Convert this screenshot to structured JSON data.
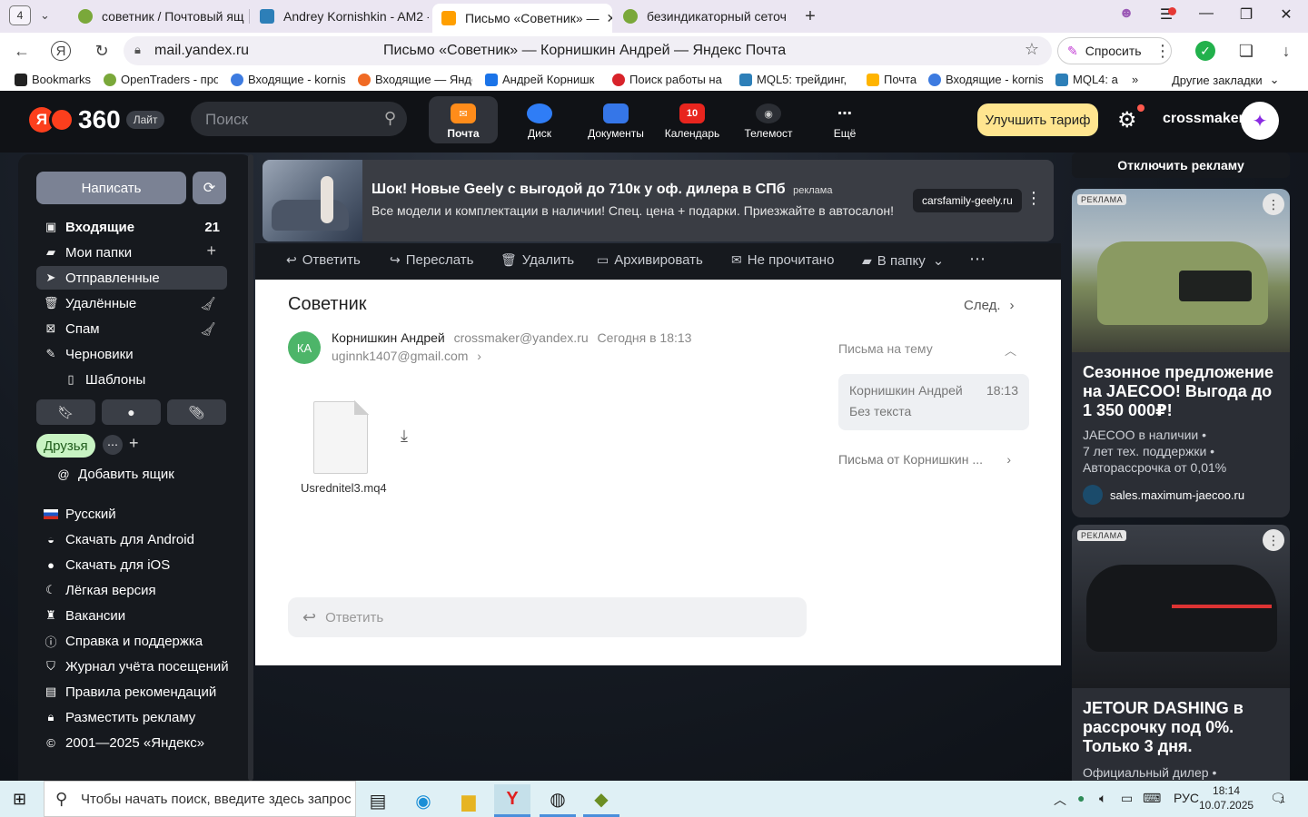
{
  "browser": {
    "tab_count": "4",
    "tabs": [
      {
        "label": "советник / Почтовый ящ",
        "icon": "opentraders-icon"
      },
      {
        "label": "Andrey Kornishkin - AM2 -",
        "icon": "mql5-icon"
      },
      {
        "label": "Письмо «Советник» —",
        "icon": "yandex-mail-icon",
        "active": true
      },
      {
        "label": "безиндикаторный сеточ",
        "icon": "opentraders-icon"
      }
    ],
    "url": "mail.yandex.ru",
    "page_title": "Письмо «Советник» — Корнишкин Андрей — Яндекс Почта",
    "ask_label": "Спросить",
    "bookmarks": [
      {
        "label": "Bookmarks",
        "color": "#222222"
      },
      {
        "label": "OpenTraders - про",
        "color": "#7aa83a"
      },
      {
        "label": "Входящие - kornis",
        "color": "#3d7be0"
      },
      {
        "label": "Входящие — Янде",
        "color": "#f06a24"
      },
      {
        "label": "Андрей Корнишк",
        "color": "#1a73e8"
      },
      {
        "label": "Поиск работы на",
        "color": "#d8232a"
      },
      {
        "label": "MQL5: трейдинг,",
        "color": "#2d7fb8"
      },
      {
        "label": "Почта",
        "color": "#ffb400"
      },
      {
        "label": "Входящие - kornis",
        "color": "#3d7be0"
      },
      {
        "label": "MQL4: а",
        "color": "#2d7fb8"
      }
    ],
    "bookmarks_more": "»",
    "other_bookmarks": "Другие закладки"
  },
  "header": {
    "logo_text": "360",
    "logo_letter": "Я",
    "lite_badge": "Лайт",
    "search_placeholder": "Поиск",
    "services": [
      {
        "label": "Почта",
        "icon": "mail-icon",
        "active": true
      },
      {
        "label": "Диск",
        "icon": "disk-icon"
      },
      {
        "label": "Документы",
        "icon": "documents-icon"
      },
      {
        "label": "Календарь",
        "icon": "calendar-icon",
        "badge": "10"
      },
      {
        "label": "Телемост",
        "icon": "telemost-icon"
      },
      {
        "label": "Ещё",
        "icon": "more-icon"
      }
    ],
    "upgrade_label": "Улучшить тариф",
    "username": "crossmaker"
  },
  "sidebar": {
    "compose_label": "Написать",
    "folders": [
      {
        "label": "Входящие",
        "count": "21",
        "icon": "inbox-icon",
        "bold": true
      },
      {
        "label": "Мои папки",
        "action": "+",
        "icon": "folder-icon"
      },
      {
        "label": "Отправленные",
        "icon": "sent-icon",
        "selected": true
      },
      {
        "label": "Удалённые",
        "action": "clean",
        "icon": "trash-icon"
      },
      {
        "label": "Спам",
        "action": "clean",
        "icon": "spam-icon"
      },
      {
        "label": "Черновики",
        "icon": "drafts-icon"
      },
      {
        "label": "Шаблоны",
        "icon": "template-icon",
        "indent": true
      }
    ],
    "label_chip": "Друзья",
    "add_mailbox": "Добавить ящик",
    "links": [
      {
        "label": "Русский",
        "icon": "russia-flag-icon"
      },
      {
        "label": "Скачать для Android",
        "icon": "android-icon"
      },
      {
        "label": "Скачать для iOS",
        "icon": "apple-icon"
      },
      {
        "label": "Лёгкая версия",
        "icon": "moon-icon"
      },
      {
        "label": "Вакансии",
        "icon": "vacancy-icon"
      },
      {
        "label": "Справка и поддержка",
        "icon": "info-icon"
      },
      {
        "label": "Журнал учёта посещений",
        "icon": "shield-icon"
      },
      {
        "label": "Правила рекомендаций",
        "icon": "rules-icon"
      },
      {
        "label": "Разместить рекламу",
        "icon": "lock-icon"
      },
      {
        "label": "2001—2025 «Яндекс»",
        "icon": "copyright-icon"
      }
    ]
  },
  "top_ad": {
    "title": "Шок! Новые Geely с выгодой до 710к у оф. дилера в СПб",
    "ad_label": "реклама",
    "text": "Все модели и комплектации в наличии! Спец. цена + подарки. Приезжайте в автосалон!",
    "domain": "carsfamily-geely.ru"
  },
  "toolbar": {
    "reply": "Ответить",
    "forward": "Переслать",
    "delete": "Удалить",
    "archive": "Архивировать",
    "unread": "Не прочитано",
    "to_folder": "В папку",
    "more": "⋯"
  },
  "letter": {
    "subject": "Советник",
    "next": "След.",
    "avatar_initials": "КА",
    "sender_name": "Корнишкин Андрей",
    "sender_email": "crossmaker@yandex.ru",
    "date": "Сегодня в 18:13",
    "recipient": "uginnk1407@gmail.com",
    "attachment_name": "Usrednitel3.mq4",
    "reply_placeholder": "Ответить"
  },
  "thread": {
    "title": "Письма на тему",
    "item_sender": "Корнишкин Андрей",
    "item_time": "18:13",
    "item_body": "Без текста",
    "from_sender": "Письма от Корнишкин ..."
  },
  "right_ads": {
    "disable_label": "Отключить рекламу",
    "tag": "РЕКЛАМА",
    "card1": {
      "title": "Сезонное предложение на JAECOO! Выгода до 1 350 000₽!",
      "lines": [
        "JAECOO в наличии •",
        "7 лет тех. поддержки •",
        "Авторассрочка от 0,01%"
      ],
      "source": "sales.maximum-jaecoo.ru"
    },
    "card2": {
      "title": "JETOUR DASHING в рассрочку под 0%. Только 3 дня.",
      "lines": [
        "Официальный дилер •"
      ]
    }
  },
  "taskbar": {
    "search_placeholder": "Чтобы начать поиск, введите здесь запрос",
    "lang": "РУС",
    "time": "18:14",
    "date": "10.07.2025",
    "notif_count": "1"
  }
}
